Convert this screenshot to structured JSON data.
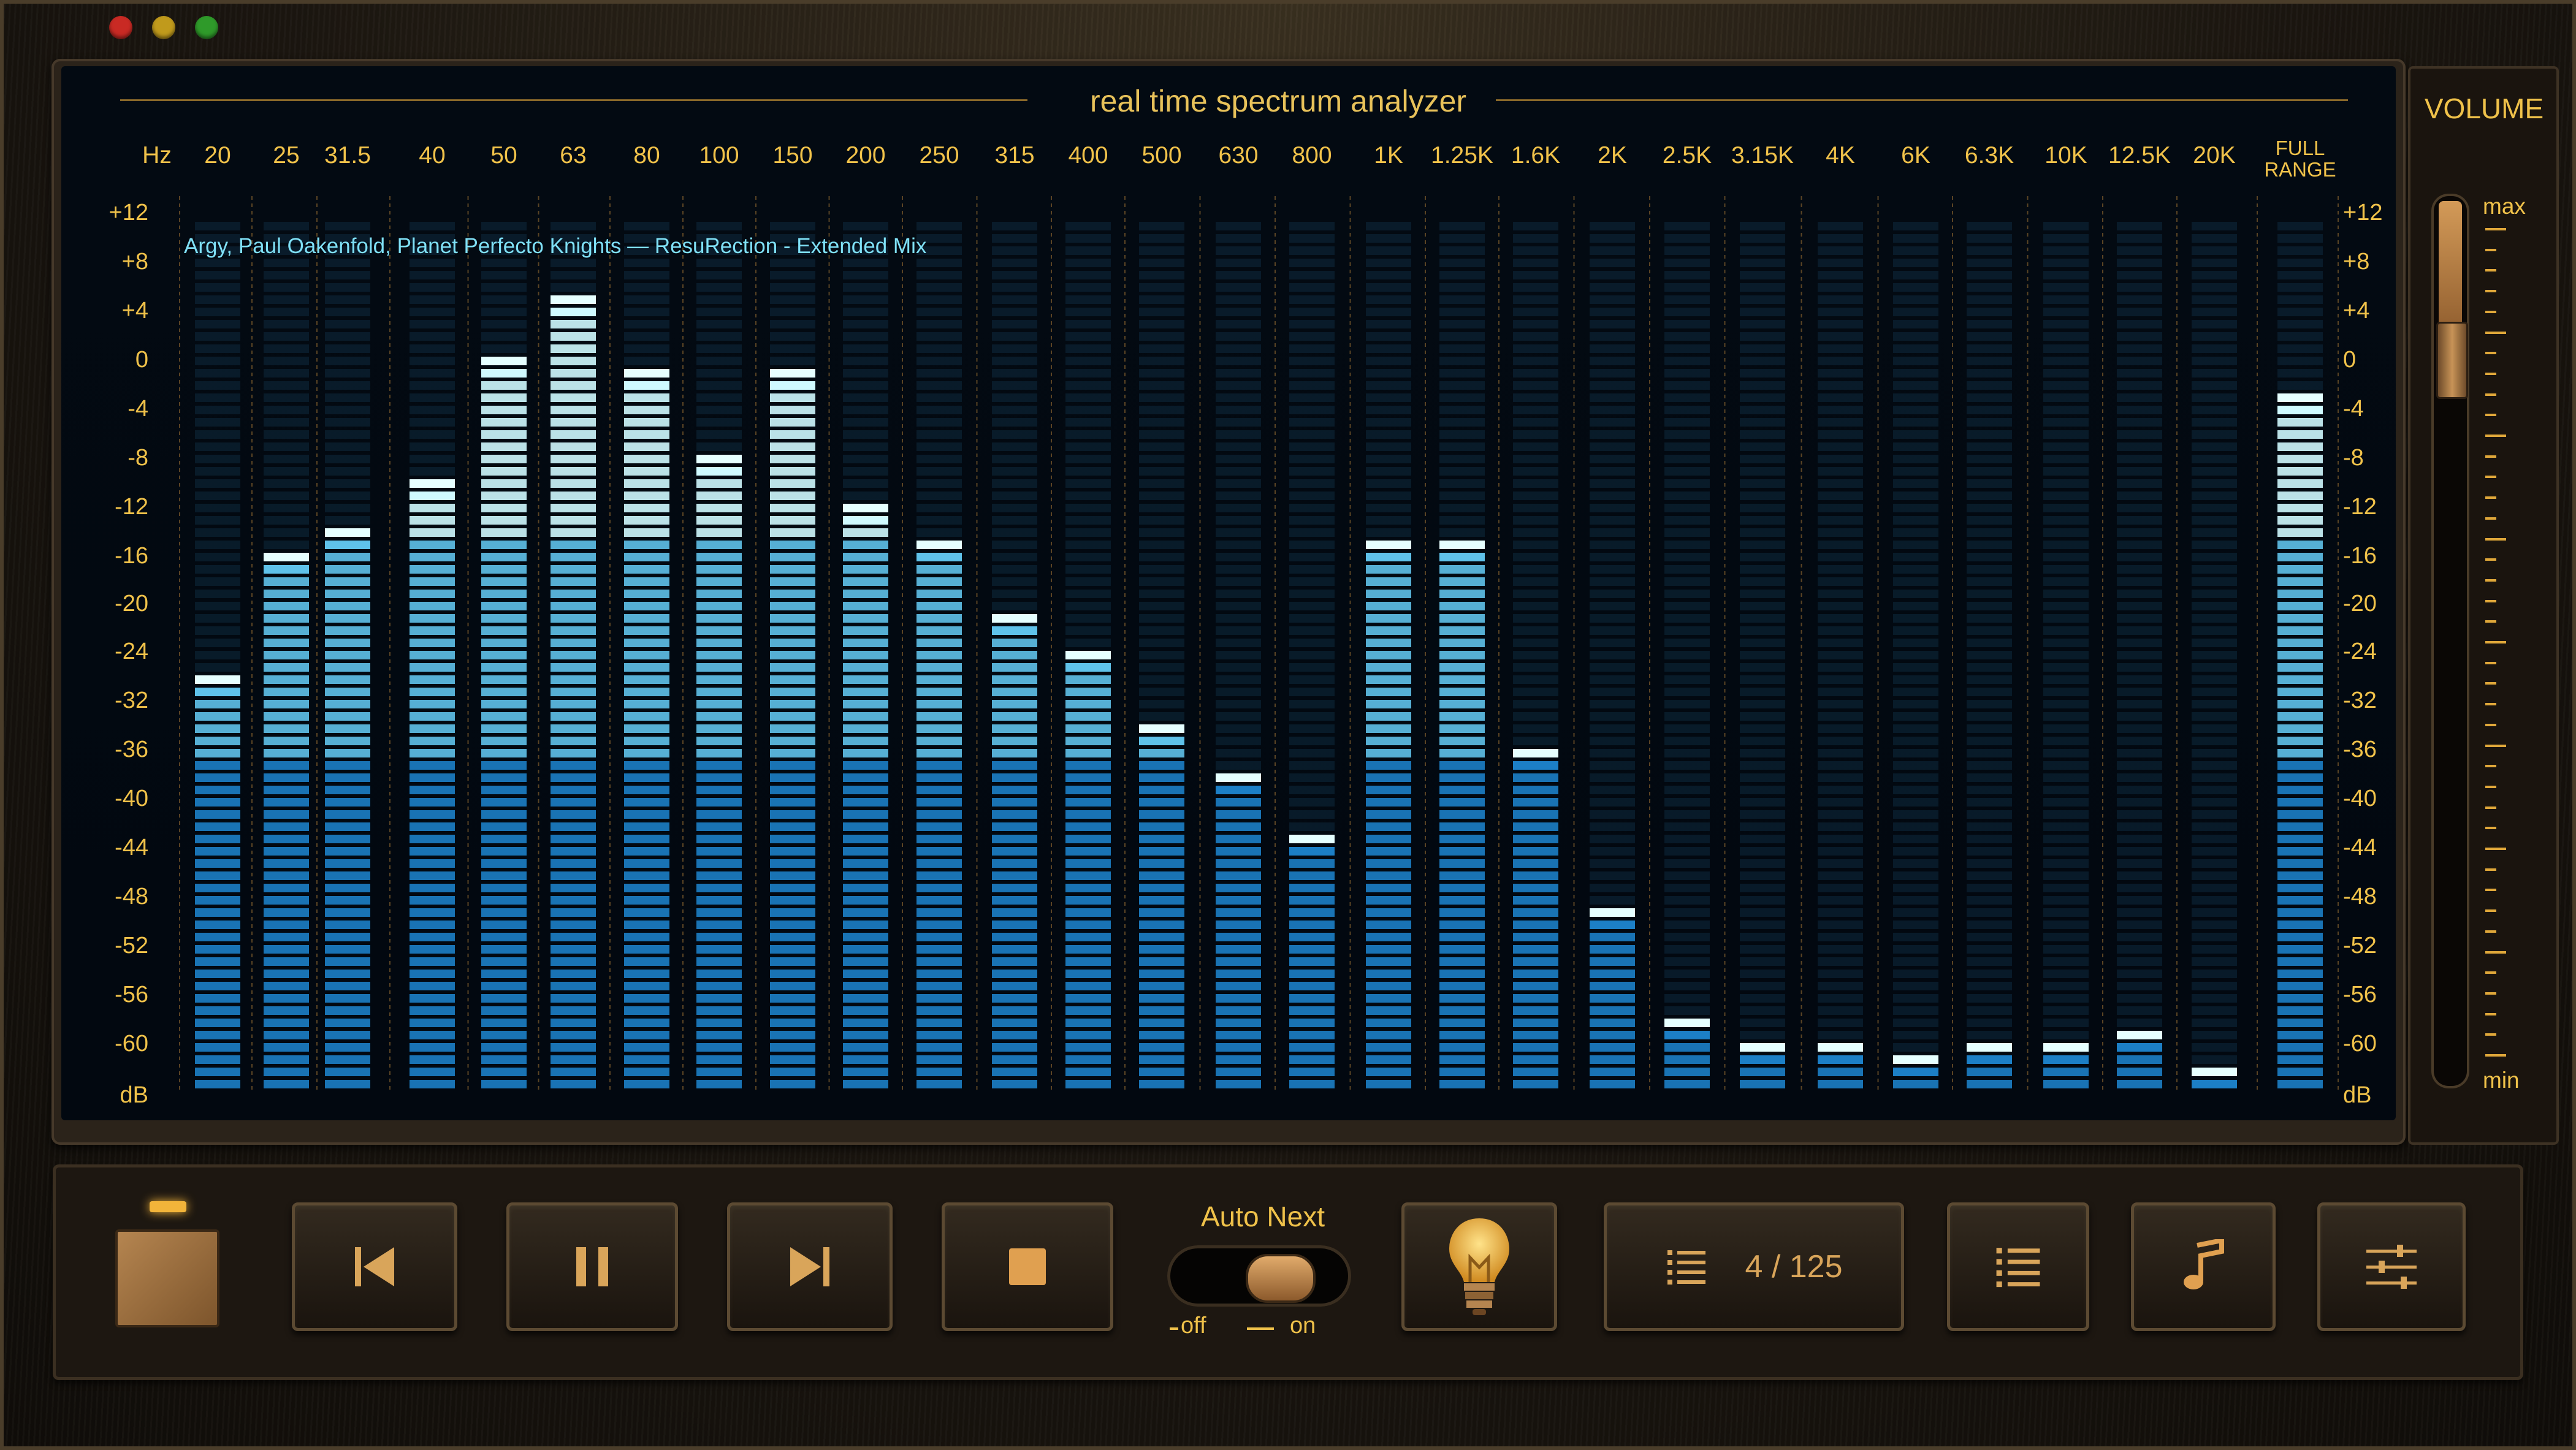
{
  "app": {
    "title": "real time spectrum analyzer"
  },
  "now_playing": "Argy, Paul Oakenfold, Planet Perfecto Knights — ResuRection - Extended Mix",
  "frequency_unit": "Hz",
  "db_unit": "dB",
  "chart_data": {
    "type": "bar",
    "title": "real time spectrum analyzer",
    "xlabel": "Hz",
    "ylabel": "dB",
    "categories": [
      "20",
      "25",
      "31.5",
      "40",
      "50",
      "63",
      "80",
      "100",
      "150",
      "200",
      "250",
      "315",
      "400",
      "500",
      "630",
      "800",
      "1K",
      "1.25K",
      "1.6K",
      "2K",
      "2.5K",
      "3.15K",
      "4K",
      "6K",
      "6.3K",
      "10K",
      "12.5K",
      "20K",
      "FULL RANGE"
    ],
    "y_ticks": [
      "+12",
      "+8",
      "+4",
      "0",
      "-4",
      "-8",
      "-12",
      "-16",
      "-20",
      "-24",
      "-32",
      "-36",
      "-40",
      "-44",
      "-48",
      "-52",
      "-56",
      "-60",
      "dB"
    ],
    "values": [
      -28,
      -17,
      -15,
      -10,
      0,
      6,
      -1,
      -8,
      -1,
      -13,
      -16,
      -22,
      -25,
      -32,
      -36,
      -41,
      -16,
      -16,
      -34,
      -48,
      -58,
      -60,
      -60,
      -61,
      -60,
      -60,
      -59,
      -62,
      -3
    ],
    "ylim": [
      -64,
      12
    ],
    "grid": true,
    "colors": {
      "bar_top": "#cffaff",
      "bar_mid": "#5fc2ea",
      "bar_low": "#1c7fc6",
      "unlit": "#0e2a3e",
      "label": "#f0c24a"
    }
  },
  "volume": {
    "label": "VOLUME",
    "max_label": "max",
    "min_label": "min",
    "level": 0.85
  },
  "controls": {
    "power": {
      "icon": "power-switch-icon",
      "state": "on"
    },
    "prev": {
      "icon": "skip-previous-icon"
    },
    "pause": {
      "icon": "pause-icon"
    },
    "next": {
      "icon": "skip-next-icon"
    },
    "stop": {
      "icon": "stop-icon"
    },
    "auto_next": {
      "label": "Auto Next",
      "off_label": "off",
      "on_label": "on",
      "state": "on"
    },
    "bulb": {
      "icon": "light-bulb-icon"
    },
    "playlist": {
      "icon": "list-icon",
      "counter": "4 / 125"
    },
    "list": {
      "icon": "list-icon"
    },
    "music": {
      "icon": "music-note-icon"
    },
    "settings": {
      "icon": "sliders-icon"
    }
  }
}
